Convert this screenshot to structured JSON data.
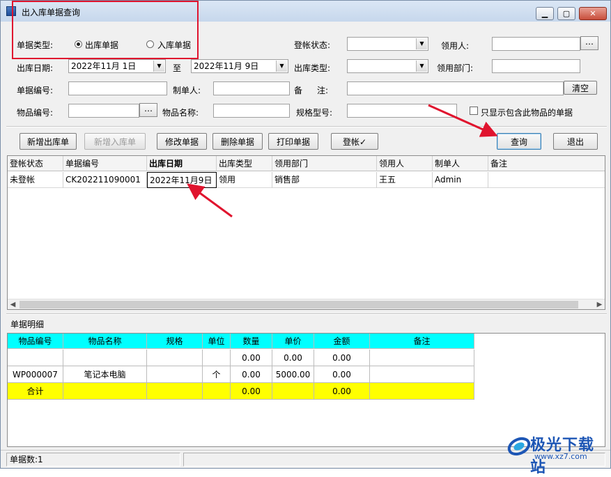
{
  "window": {
    "title": "出入库单据查询"
  },
  "filters": {
    "doc_type_label": "单据类型:",
    "doc_type_options": [
      {
        "label": "出库单据",
        "selected": true
      },
      {
        "label": "入库单据",
        "selected": false
      }
    ],
    "post_status_label": "登帐状态:",
    "post_status_value": "",
    "recipient_label": "领用人:",
    "recipient_value": "",
    "date_label": "出库日期:",
    "date_from": "2022年11月 1日",
    "date_to_label": "至",
    "date_to": "2022年11月 9日",
    "out_type_label": "出库类型:",
    "out_type_value": "",
    "dept_label": "领用部门:",
    "dept_value": "",
    "doc_no_label": "单据编号:",
    "doc_no_value": "",
    "maker_label": "制单人:",
    "maker_value": "",
    "remark_label_a": "备",
    "remark_label_b": "注:",
    "remark_value": "",
    "clear_label": "清空",
    "item_no_label": "物品编号:",
    "item_no_value": "",
    "item_name_label": "物品名称:",
    "item_name_value": "",
    "spec_label": "规格型号:",
    "spec_value": "",
    "only_show_label": "只显示包含此物品的单据",
    "only_show_checked": false
  },
  "toolbar": {
    "new_out": "新增出库单",
    "new_in": "新增入库单",
    "edit": "修改单据",
    "delete": "删除单据",
    "print": "打印单据",
    "post": "登帐✓",
    "query": "查询",
    "exit": "退出"
  },
  "main_grid": {
    "columns": [
      "登帐状态",
      "单据编号",
      "出库日期",
      "出库类型",
      "领用部门",
      "领用人",
      "制单人",
      "备注"
    ],
    "rows": [
      [
        "未登帐",
        "CK202211090001",
        "2022年11月9日",
        "领用",
        "销售部",
        "王五",
        "Admin",
        ""
      ]
    ]
  },
  "detail": {
    "section_label": "单据明细",
    "columns": [
      "物品编号",
      "物品名称",
      "规格",
      "单位",
      "数量",
      "单价",
      "金额",
      "备注"
    ],
    "rows": [
      [
        "",
        "",
        "",
        "",
        "0.00",
        "0.00",
        "0.00",
        ""
      ],
      [
        "WP000007",
        "笔记本电脑",
        "",
        "个",
        "0.00",
        "5000.00",
        "0.00",
        ""
      ]
    ],
    "total_row": [
      "合计",
      "",
      "",
      "",
      "0.00",
      "",
      "0.00",
      ""
    ]
  },
  "status": {
    "count_text": "单据数:1"
  },
  "watermark": {
    "name": "极光下载站",
    "url": "www.xz7.com"
  },
  "colors": {
    "header_cyan": "#00ffff",
    "total_yellow": "#ffff00",
    "annotation_red": "#e0142e"
  }
}
